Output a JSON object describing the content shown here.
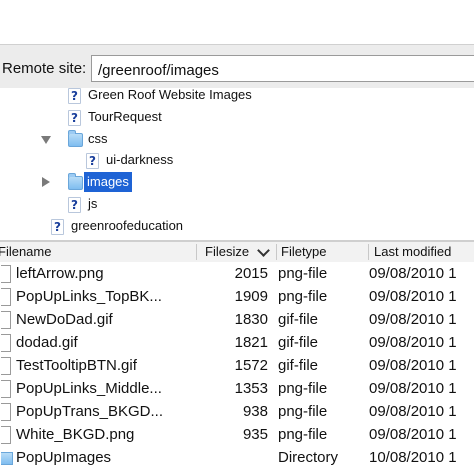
{
  "remote_site": {
    "label": "Remote site:",
    "path": "/greenroof/images"
  },
  "tree": [
    {
      "label": "Green Roof Website Images",
      "icon": "question-icon",
      "indent": 1
    },
    {
      "label": "TourRequest",
      "icon": "question-icon",
      "indent": 1
    },
    {
      "label": "css",
      "icon": "folder-icon",
      "indent": 1,
      "expander": "expanded"
    },
    {
      "label": "ui-darkness",
      "icon": "question-icon",
      "indent": 2
    },
    {
      "label": "images",
      "icon": "folder-icon",
      "indent": 1,
      "expander": "collapsed",
      "selected": true
    },
    {
      "label": "js",
      "icon": "question-icon",
      "indent": 1
    },
    {
      "label": "greenroofeducation",
      "icon": "question-icon",
      "indent": 0
    }
  ],
  "file_list": {
    "columns": [
      "Filename",
      "Filesize",
      "Filetype",
      "Last modified"
    ],
    "sort_column": "Filesize",
    "rows": [
      {
        "name": "leftArrow.png",
        "size": "2015",
        "type": "png-file",
        "modified": "09/08/2010 1"
      },
      {
        "name": "PopUpLinks_TopBK...",
        "size": "1909",
        "type": "png-file",
        "modified": "09/08/2010 1"
      },
      {
        "name": "NewDoDad.gif",
        "size": "1830",
        "type": "gif-file",
        "modified": "09/08/2010 1"
      },
      {
        "name": "dodad.gif",
        "size": "1821",
        "type": "gif-file",
        "modified": "09/08/2010 1"
      },
      {
        "name": "TestTooltipBTN.gif",
        "size": "1572",
        "type": "gif-file",
        "modified": "09/08/2010 1"
      },
      {
        "name": "PopUpLinks_Middle...",
        "size": "1353",
        "type": "png-file",
        "modified": "09/08/2010 1"
      },
      {
        "name": "PopUpTrans_BKGD...",
        "size": "938",
        "type": "png-file",
        "modified": "09/08/2010 1"
      },
      {
        "name": "White_BKGD.png",
        "size": "935",
        "type": "png-file",
        "modified": "09/08/2010 1"
      },
      {
        "name": "PopUpImages",
        "size": "",
        "type": "Directory",
        "modified": "10/08/2010 1",
        "is_dir": true
      }
    ]
  }
}
